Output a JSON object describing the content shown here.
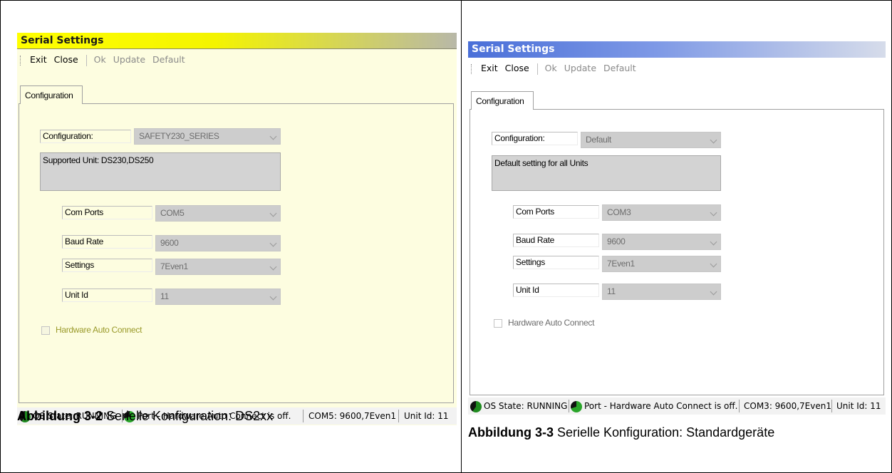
{
  "left": {
    "title": "Serial Settings",
    "toolbar": {
      "exit": "Exit",
      "close": "Close",
      "ok": "Ok",
      "update": "Update",
      "default": "Default"
    },
    "tab": "Configuration",
    "configuration_label": "Configuration:",
    "configuration_value": "SAFETY230_SERIES",
    "description": "Supported Unit: DS230,DS250",
    "com_ports_label": "Com Ports",
    "com_ports_value": "COM5",
    "baud_rate_label": "Baud Rate",
    "baud_rate_value": "9600",
    "settings_label": "Settings",
    "settings_value": "7Even1",
    "unit_id_label": "Unit Id",
    "unit_id_value": "11",
    "hardware_auto_connect": "Hardware Auto Connect",
    "status": {
      "os_state": "OS State: RUNNING",
      "port": "Port - Hardware Auto Connect is off.",
      "com": "COM5: 9600,7Even1",
      "unit": "Unit Id: 11"
    },
    "caption_bold": "Abbildung 3-2",
    "caption_text": " Serielle Konfiguration: DS2xx"
  },
  "right": {
    "title": "Serial Settings",
    "toolbar": {
      "exit": "Exit",
      "close": "Close",
      "ok": "Ok",
      "update": "Update",
      "default": "Default"
    },
    "tab": "Configuration",
    "configuration_label": "Configuration:",
    "configuration_value": "Default",
    "description": "Default setting for all Units",
    "com_ports_label": "Com Ports",
    "com_ports_value": "COM3",
    "baud_rate_label": "Baud Rate",
    "baud_rate_value": "9600",
    "settings_label": "Settings",
    "settings_value": "7Even1",
    "unit_id_label": "Unit Id",
    "unit_id_value": "11",
    "hardware_auto_connect": "Hardware Auto Connect",
    "status": {
      "os_state": "OS State: RUNNING",
      "port": "Port - Hardware Auto Connect is off.",
      "com": "COM3: 9600,7Even1",
      "unit": "Unit Id: 11"
    },
    "caption_bold": "Abbildung 3-3",
    "caption_text": " Serielle Konfiguration: Standardgeräte"
  },
  "colors": {
    "left_title_bar": "#ffff00",
    "right_title_bar": "#4a6fd8",
    "left_background": "#fdfde0",
    "status_running": "#1f8a1f"
  }
}
